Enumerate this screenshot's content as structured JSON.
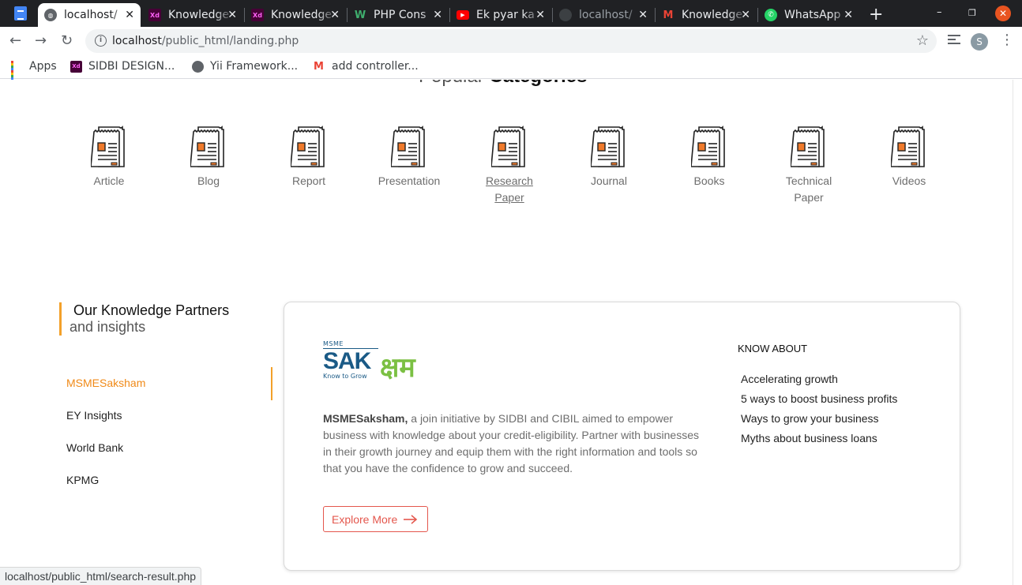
{
  "browser": {
    "tabs": [
      {
        "label": "localhost/",
        "icon": "globe-icon",
        "active": true
      },
      {
        "label": "Knowledge",
        "icon": "adobe-xd-icon"
      },
      {
        "label": "Knowledge",
        "icon": "adobe-xd-icon"
      },
      {
        "label": "PHP Cons",
        "icon": "w-icon"
      },
      {
        "label": "Ek pyar ka",
        "icon": "youtube-icon"
      },
      {
        "label": "localhost/",
        "icon": "globe-icon"
      },
      {
        "label": "Knowledge",
        "icon": "gmail-icon"
      },
      {
        "label": "WhatsApp",
        "icon": "whatsapp-icon"
      }
    ],
    "url_host": "localhost",
    "url_path": "/public_html/landing.php",
    "profile_initial": "S",
    "bookmarks": [
      {
        "label": "Apps",
        "icon": "apps-grid-icon"
      },
      {
        "label": "SIDBI DESIGN...",
        "icon": "adobe-xd-icon"
      },
      {
        "label": "Yii Framework...",
        "icon": "globe-icon"
      },
      {
        "label": "add controller...",
        "icon": "gmail-icon"
      }
    ],
    "status_url": "localhost/public_html/search-result.php"
  },
  "categories": {
    "title_light": "Popular ",
    "title_bold": "Categories",
    "items": [
      {
        "label": "Article"
      },
      {
        "label": "Blog"
      },
      {
        "label": "Report"
      },
      {
        "label": "Presentation"
      },
      {
        "label": "Research Paper",
        "hovered": true
      },
      {
        "label": "Journal"
      },
      {
        "label": "Books"
      },
      {
        "label": "Technical Paper"
      },
      {
        "label": "Videos"
      }
    ]
  },
  "partners": {
    "heading_line1": "Our Knowledge Partners",
    "heading_line2": "and insights",
    "list": [
      {
        "label": "MSMESaksham",
        "active": true
      },
      {
        "label": "EY Insights"
      },
      {
        "label": "World Bank"
      },
      {
        "label": "KPMG"
      }
    ],
    "card": {
      "logo_top": "MSME",
      "logo_main": "SAK",
      "logo_deva": "क्षम",
      "logo_tag": "Know to Grow",
      "desc_bold": "MSMESaksham,",
      "desc_rest": " a join initiative by SIDBI and CIBIL aimed to empower business with knowledge about your credit-eligibility. Partner with businesses in their growth journey and equip them with the right information and tools so that you have the confidence to grow and succeed.",
      "explore_label": "Explore More",
      "know_title": "KNOW ABOUT",
      "know_items": [
        "Accelerating growth",
        "5 ways to boost business profits",
        "Ways to grow your business",
        "Myths about business loans"
      ]
    }
  },
  "colors": {
    "accent": "#f3a12a",
    "active_link": "#f08a18",
    "explore": "#e4574d",
    "brand_blue": "#1a5a86",
    "brand_green": "#7bc043"
  }
}
